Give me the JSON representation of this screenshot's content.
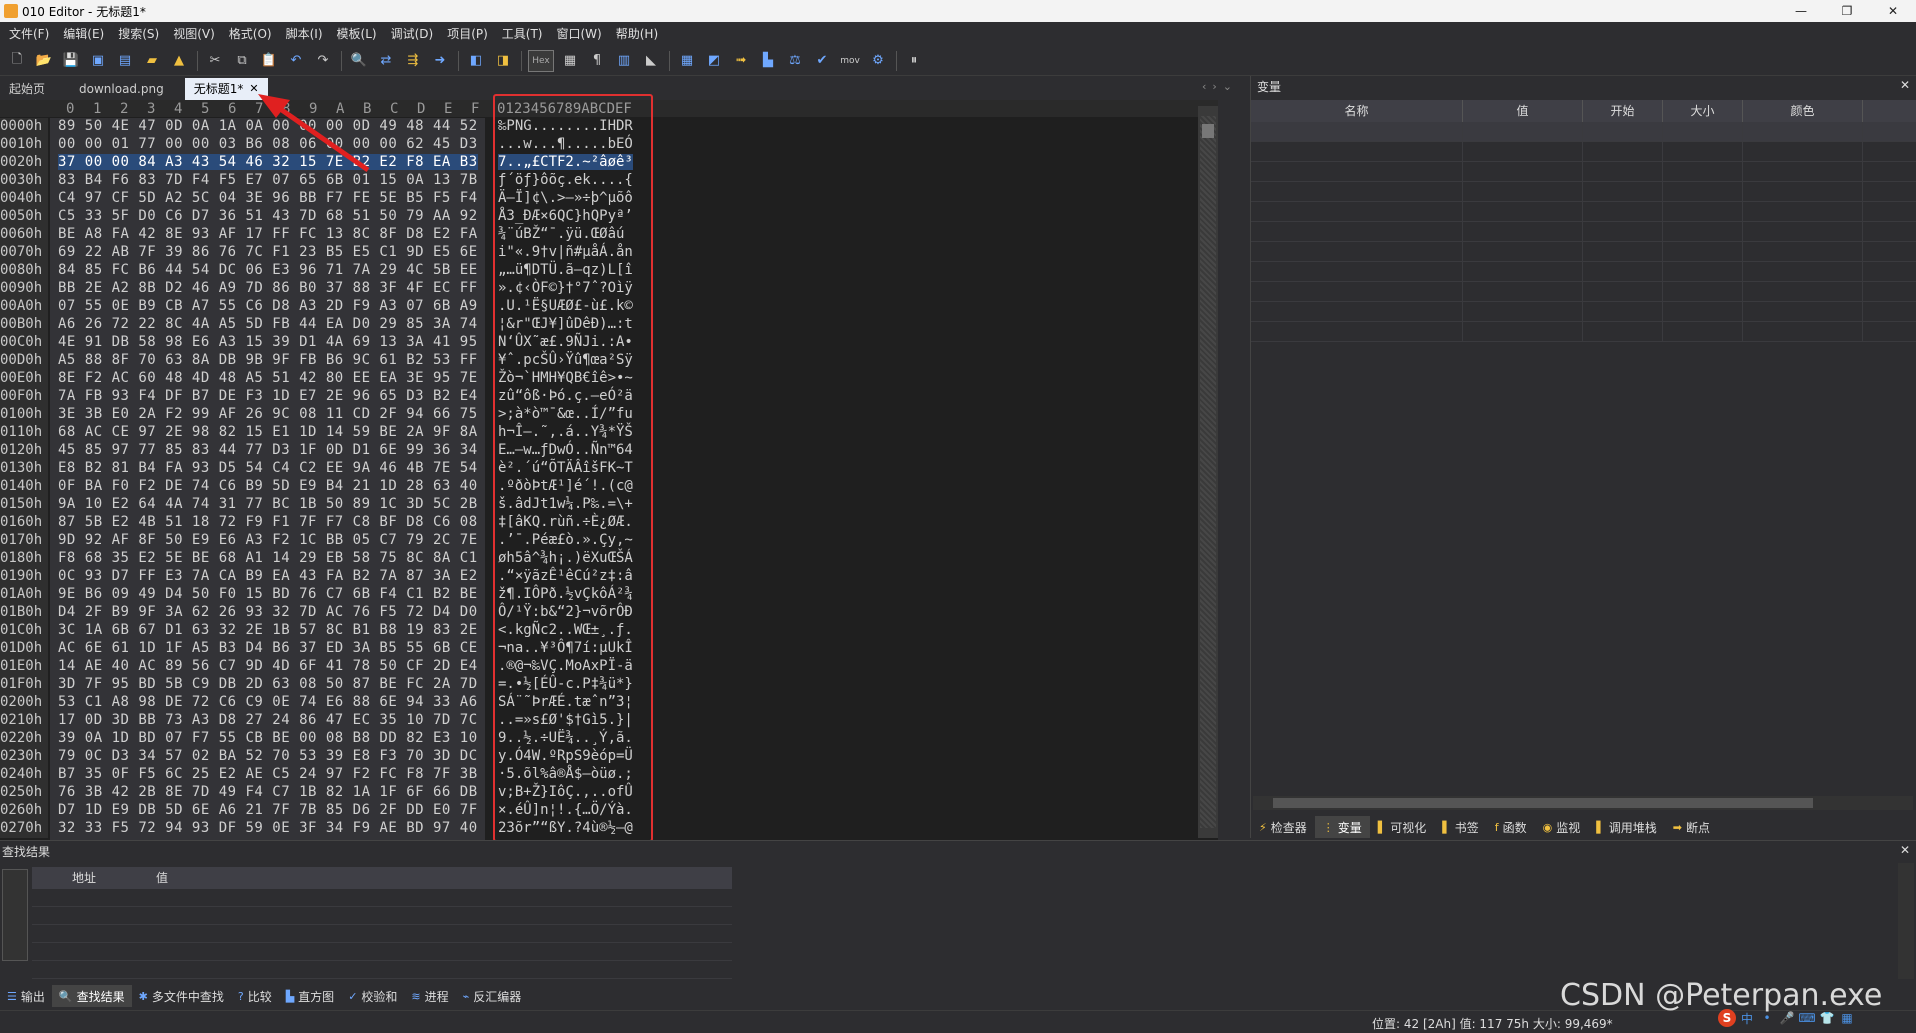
{
  "window": {
    "title": "010 Editor - 无标题1*",
    "controls": [
      "—",
      "❐",
      "✕"
    ]
  },
  "menu": [
    "文件(F)",
    "编辑(E)",
    "搜索(S)",
    "视图(V)",
    "格式(O)",
    "脚本(I)",
    "模板(L)",
    "调试(D)",
    "项目(P)",
    "工具(T)",
    "窗口(W)",
    "帮助(H)"
  ],
  "toolbar": {
    "hex_label": "Hex",
    "mov_label": "mov"
  },
  "tabs": [
    {
      "label": "起始页",
      "active": false
    },
    {
      "label": "download.png",
      "active": false
    },
    {
      "label": "无标题1*",
      "active": true,
      "close": "✕"
    }
  ],
  "hex_view": {
    "column_header": [
      "0",
      "1",
      "2",
      "3",
      "4",
      "5",
      "6",
      "7",
      "8",
      "9",
      "A",
      "B",
      "C",
      "D",
      "E",
      "F"
    ],
    "text_header": "0123456789ABCDEF",
    "rows": [
      {
        "addr": "0000h",
        "hex": "89 50 4E 47 0D 0A 1A 0A 00 00 00 0D 49 48 44 52",
        "text": "‰PNG........IHDR"
      },
      {
        "addr": "0010h",
        "hex": "00 00 01 77 00 00 03 B6 08 06 00 00 00 62 45 D3",
        "text": "...w...¶.....bEÓ"
      },
      {
        "addr": "0020h",
        "hex": "37 00 00 84 A3 43 54 46 32 15 7E B2 E2 F8 EA B3",
        "text": "7..„£CTF2.~²âøê³",
        "selected": true
      },
      {
        "addr": "0030h",
        "hex": "83 B4 F6 83 7D F4 F5 E7 07 65 6B 01 15 0A 13 7B",
        "text": "ƒ´öƒ}ôõç.ek....{"
      },
      {
        "addr": "0040h",
        "hex": "C4 97 CF 5D A2 5C 04 3E 96 BB F7 FE 5E B5 F5 F4",
        "text": "Ä—Ï]¢\\.>–»÷þ^µõô"
      },
      {
        "addr": "0050h",
        "hex": "C5 33 5F D0 C6 D7 36 51 43 7D 68 51 50 79 AA 92",
        "text": "Å3_ÐÆ×6QC}hQPyª’"
      },
      {
        "addr": "0060h",
        "hex": "BE A8 FA 42 8E 93 AF 17 FF FC 13 8C 8F D8 E2 FA",
        "text": "¾¨úBŽ“¯.ÿü.ŒØâú"
      },
      {
        "addr": "0070h",
        "hex": "69 22 AB 7F 39 86 76 7C F1 23 B5 E5 C1 9D E5 6E",
        "text": "i\"«.9†v|ñ#µåÁ.ån"
      },
      {
        "addr": "0080h",
        "hex": "84 85 FC B6 44 54 DC 06 E3 96 71 7A 29 4C 5B EE",
        "text": "„…ü¶DTÜ.ã–qz)L[î"
      },
      {
        "addr": "0090h",
        "hex": "BB 2E A2 8B D2 46 A9 7D 86 B0 37 88 3F 4F EC FF",
        "text": "».¢‹ÒF©}†°7ˆ?Oìÿ"
      },
      {
        "addr": "00A0h",
        "hex": "07 55 0E B9 CB A7 55 C6 D8 A3 2D F9 A3 07 6B A9",
        "text": ".U.¹Ë§UÆØ£-ù£.k©"
      },
      {
        "addr": "00B0h",
        "hex": "A6 26 72 22 8C 4A A5 5D FB 44 EA D0 29 85 3A 74",
        "text": "¦&r\"ŒJ¥]ûDêÐ)…:t"
      },
      {
        "addr": "00C0h",
        "hex": "4E 91 DB 58 98 E6 A3 15 39 D1 4A 69 13 3A 41 95",
        "text": "N‘ÛX˜æ£.9ÑJi.:A•"
      },
      {
        "addr": "00D0h",
        "hex": "A5 88 8F 70 63 8A DB 9B 9F FB B6 9C 61 B2 53 FF",
        "text": "¥ˆ.pcŠÛ›Ÿû¶œa²Sÿ"
      },
      {
        "addr": "00E0h",
        "hex": "8E F2 AC 60 48 4D 48 A5 51 42 80 EE EA 3E 95 7E",
        "text": "Žò¬`HMH¥QB€îê>•~"
      },
      {
        "addr": "00F0h",
        "hex": "7A FB 93 F4 DF B7 DE F3 1D E7 2E 96 65 D3 B2 E4",
        "text": "zû“ôß·Þó.ç.–eÓ²ä"
      },
      {
        "addr": "0100h",
        "hex": "3E 3B E0 2A F2 99 AF 26 9C 08 11 CD 2F 94 66 75",
        "text": ">;à*ò™¯&œ..Í/”fu"
      },
      {
        "addr": "0110h",
        "hex": "68 AC CE 97 2E 98 82 15 E1 1D 14 59 BE 2A 9F 8A",
        "text": "h¬Î—.˜‚.á..Y¾*ŸŠ"
      },
      {
        "addr": "0120h",
        "hex": "45 85 97 77 85 83 44 77 D3 1F 0D D1 6E 99 36 34",
        "text": "E…—w…ƒDwÓ..Ñn™64"
      },
      {
        "addr": "0130h",
        "hex": "E8 B2 81 B4 FA 93 D5 54 C4 C2 EE 9A 46 4B 7E 54",
        "text": "è².´ú“ÕTÄÂîšFK~T"
      },
      {
        "addr": "0140h",
        "hex": "0F BA F0 F2 DE 74 C6 B9 5D E9 B4 21 1D 28 63 40",
        "text": ".ºðòÞtÆ¹]é´!.(c@"
      },
      {
        "addr": "0150h",
        "hex": "9A 10 E2 64 4A 74 31 77 BC 1B 50 89 1C 3D 5C 2B",
        "text": "š.âdJt1w¼.P‰.=\\+"
      },
      {
        "addr": "0160h",
        "hex": "87 5B E2 4B 51 18 72 F9 F1 7F F7 C8 BF D8 C6 08",
        "text": "‡[âKQ.rùñ.÷È¿ØÆ."
      },
      {
        "addr": "0170h",
        "hex": "9D 92 AF 8F 50 E9 E6 A3 F2 1C BB 05 C7 79 2C 7E",
        "text": ".’¯.Péæ£ò.».Çy,~"
      },
      {
        "addr": "0180h",
        "hex": "F8 68 35 E2 5E BE 68 A1 14 29 EB 58 75 8C 8A C1",
        "text": "øh5â^¾h¡.)ëXuŒŠÁ"
      },
      {
        "addr": "0190h",
        "hex": "0C 93 D7 FF E3 7A CA B9 EA 43 FA B2 7A 87 3A E2",
        "text": ".“×ÿãzÊ¹êCú²z‡:â"
      },
      {
        "addr": "01A0h",
        "hex": "9E B6 09 49 D4 50 F0 15 BD 76 C7 6B F4 C1 B2 BE",
        "text": "ž¶.IÔPð.½vÇkôÁ²¾"
      },
      {
        "addr": "01B0h",
        "hex": "D4 2F B9 9F 3A 62 26 93 32 7D AC 76 F5 72 D4 D0",
        "text": "Ô/¹Ÿ:b&“2}¬võrÔÐ"
      },
      {
        "addr": "01C0h",
        "hex": "3C 1A 6B 67 D1 63 32 2E 1B 57 8C B1 B8 19 83 2E",
        "text": "<.kgÑc2..WŒ±¸.ƒ."
      },
      {
        "addr": "01D0h",
        "hex": "AC 6E 61 1D 1F A5 B3 D4 B6 37 ED 3A B5 55 6B CE",
        "text": "¬na..¥³Ô¶7í:µUkÎ"
      },
      {
        "addr": "01E0h",
        "hex": "14 AE 40 AC 89 56 C7 9D 4D 6F 41 78 50 CF 2D E4",
        "text": ".®@¬‰VÇ.MoAxPÏ-ä"
      },
      {
        "addr": "01F0h",
        "hex": "3D 7F 95 BD 5B C9 DB 2D 63 08 50 87 BE FC 2A 7D",
        "text": "=.•½[ÉÛ-c.P‡¾ü*}"
      },
      {
        "addr": "0200h",
        "hex": "53 C1 A8 98 DE 72 C6 C9 0E 74 E6 88 6E 94 33 A6",
        "text": "SÁ¨˜ÞrÆÉ.tæˆn”3¦"
      },
      {
        "addr": "0210h",
        "hex": "17 0D 3D BB 73 A3 D8 27 24 86 47 EC 35 10 7D 7C",
        "text": "..=»s£Ø'$†Gì5.}|"
      },
      {
        "addr": "0220h",
        "hex": "39 0A 1D BD 07 F7 55 CB BE 00 08 B8 DD 82 E3 10",
        "text": "9..½.÷UË¾..¸Ý‚ã."
      },
      {
        "addr": "0230h",
        "hex": "79 0C D3 34 57 02 BA 52 70 53 39 E8 F3 70 3D DC",
        "text": "y.Ó4W.ºRpS9èóp=Ü"
      },
      {
        "addr": "0240h",
        "hex": "B7 35 0F F5 6C 25 E2 AE C5 24 97 F2 FC F8 7F 3B",
        "text": "·5.õl%â®Å$—òüø.;"
      },
      {
        "addr": "0250h",
        "hex": "76 3B 42 2B 8E 7D 49 F4 C7 1B 82 1A 1F 6F 66 DB",
        "text": "v;B+Ž}IôÇ.‚..ofÛ"
      },
      {
        "addr": "0260h",
        "hex": "D7 1D E9 DB 5D 6E A6 21 7F 7B 85 D6 2F DD E0 7F",
        "text": "×.éÛ]n¦!.{…Ö/Ýà."
      },
      {
        "addr": "0270h",
        "hex": "32 33 F5 72 94 93 DF 59 0E 3F 34 F9 AE BD 97 40",
        "text": "23õr”“ßY.?4ù®½—@"
      }
    ]
  },
  "variables_panel": {
    "title": "变量",
    "close": "✕",
    "columns": [
      "名称",
      "值",
      "开始",
      "大小",
      "颜色"
    ],
    "tabs": [
      {
        "label": "检查器",
        "icon": "⚡",
        "active": false
      },
      {
        "label": "变量",
        "icon": "⋮",
        "active": true
      },
      {
        "label": "可视化",
        "icon": "▌",
        "active": false
      },
      {
        "label": "书签",
        "icon": "▌",
        "active": false
      },
      {
        "label": "函数",
        "icon": "f",
        "active": false
      },
      {
        "label": "监视",
        "icon": "◉",
        "active": false
      },
      {
        "label": "调用堆栈",
        "icon": "▌",
        "active": false
      },
      {
        "label": "断点",
        "icon": "➡",
        "active": false
      }
    ]
  },
  "find_panel": {
    "title": "查找结果",
    "close": "✕",
    "columns": [
      "地址",
      "值"
    ]
  },
  "bottom_tabs": [
    {
      "label": "输出",
      "icon": "☰",
      "active": false
    },
    {
      "label": "查找结果",
      "icon": "🔍",
      "active": true
    },
    {
      "label": "多文件中查找",
      "icon": "✱",
      "active": false
    },
    {
      "label": "比较",
      "icon": "?",
      "active": false
    },
    {
      "label": "直方图",
      "icon": "▙",
      "active": false
    },
    {
      "label": "校验和",
      "icon": "✓",
      "active": false
    },
    {
      "label": "进程",
      "icon": "≋",
      "active": false
    },
    {
      "label": "反汇编器",
      "icon": "⌁",
      "active": false
    }
  ],
  "status": {
    "text": "位置: 42 [2Ah]   值: 117 75h   大小: 99,469*"
  },
  "watermark": "CSDN @Peterpan.exe",
  "tray": [
    "S",
    "中",
    "•",
    "🎤",
    "⌨",
    "👕",
    "▦"
  ]
}
